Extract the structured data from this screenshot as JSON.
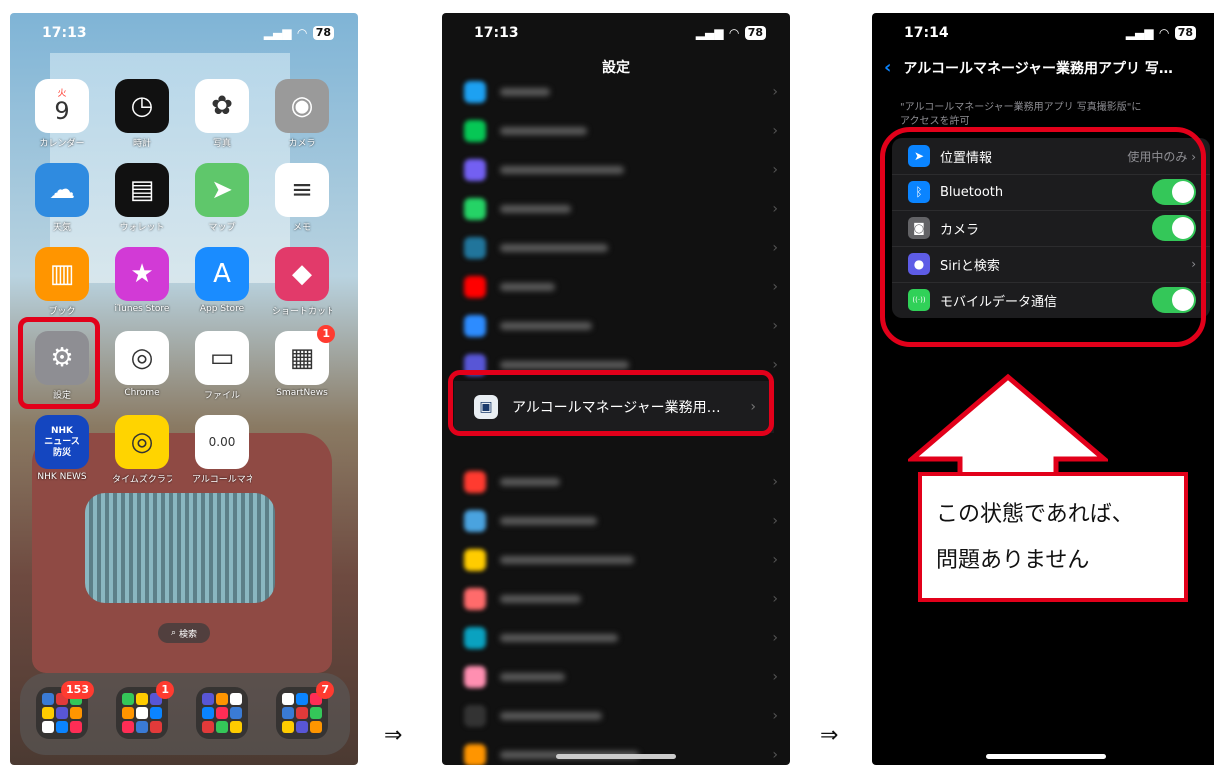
{
  "arrow_symbol": "⇒",
  "phone1": {
    "status": {
      "time": "17:13",
      "battery": "78"
    },
    "apps": [
      {
        "label": "カレンダー",
        "glyph": "9",
        "sub": "火",
        "color": "#ffffff"
      },
      {
        "label": "時計",
        "glyph": "◷",
        "color": "#111111"
      },
      {
        "label": "写真",
        "glyph": "✿",
        "color": "#ffffff"
      },
      {
        "label": "カメラ",
        "glyph": "◉",
        "color": "#9a9a9a"
      },
      {
        "label": "天気",
        "glyph": "☁",
        "color": "#2f8be0"
      },
      {
        "label": "ウォレット",
        "glyph": "▤",
        "color": "#111111"
      },
      {
        "label": "マップ",
        "glyph": "➤",
        "color": "#5fc76b"
      },
      {
        "label": "メモ",
        "glyph": "≡",
        "color": "#ffffff"
      },
      {
        "label": "ブック",
        "glyph": "▥",
        "color": "#ff9500"
      },
      {
        "label": "iTunes Store",
        "glyph": "★",
        "color": "#d23ad6"
      },
      {
        "label": "App Store",
        "glyph": "A",
        "color": "#1a8cff"
      },
      {
        "label": "ショートカット",
        "glyph": "◆",
        "color": "#e23a6a"
      },
      {
        "label": "設定",
        "glyph": "⚙",
        "color": "#8e8e93"
      },
      {
        "label": "Chrome",
        "glyph": "◎",
        "color": "#ffffff"
      },
      {
        "label": "ファイル",
        "glyph": "▭",
        "color": "#ffffff"
      },
      {
        "label": "SmartNews",
        "glyph": "▦",
        "color": "#ffffff",
        "badge": "1"
      },
      {
        "label": "NHK NEWS",
        "glyph": "NHK\nニュース\n防災",
        "color": "#1446c0"
      },
      {
        "label": "タイムズクラブ",
        "glyph": "◎",
        "color": "#ffd400"
      },
      {
        "label": "アルコールマネ...",
        "glyph": "0.00",
        "color": "#ffffff"
      }
    ],
    "search_label": "検索",
    "dock": [
      {
        "badge": "153"
      },
      {
        "badge": "1"
      },
      {
        "badge": ""
      },
      {
        "badge": "7"
      }
    ]
  },
  "phone2": {
    "status": {
      "time": "17:13",
      "battery": "78"
    },
    "title": "設定",
    "highlighted_row": "アルコールマネージャー業務用…"
  },
  "phone3": {
    "status": {
      "time": "17:14",
      "battery": "78"
    },
    "title": "アルコールマネージャー業務用アプリ 写…",
    "subtitle": "\"アルコールマネージャー業務用アプリ 写真撮影版\"に\nアクセスを許可",
    "rows": [
      {
        "label": "位置情報",
        "value": "使用中のみ",
        "type": "value",
        "icon": "➤",
        "color": "#0a84ff"
      },
      {
        "label": "Bluetooth",
        "type": "toggle",
        "on": true,
        "icon": "ᛒ",
        "color": "#0a84ff"
      },
      {
        "label": "カメラ",
        "type": "toggle",
        "on": true,
        "icon": "◙",
        "color": "#636366"
      },
      {
        "label": "Siriと検索",
        "type": "chevron",
        "icon": "●",
        "color": "#5e5ce6"
      },
      {
        "label": "モバイルデータ通信",
        "type": "toggle",
        "on": true,
        "icon": "((·))",
        "color": "#30d158"
      }
    ],
    "callout": [
      "この状態であれば、",
      "問題ありません"
    ]
  }
}
